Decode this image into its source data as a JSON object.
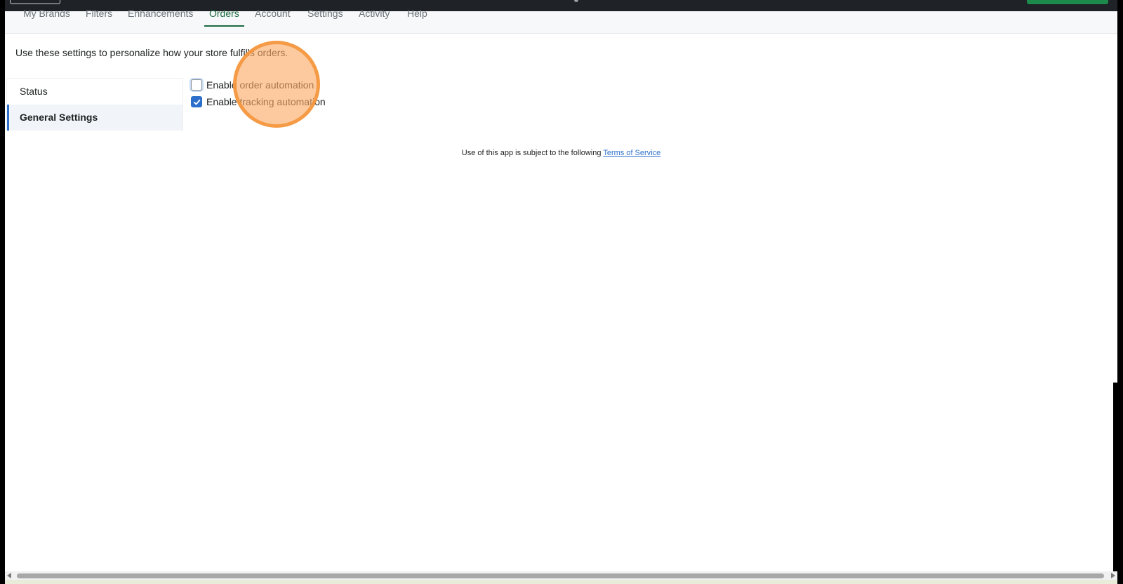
{
  "nav": {
    "tabs": [
      {
        "label": "My Brands"
      },
      {
        "label": "Filters"
      },
      {
        "label": "Enhancements"
      },
      {
        "label": "Orders"
      },
      {
        "label": "Account"
      },
      {
        "label": "Settings"
      },
      {
        "label": "Activity"
      },
      {
        "label": "Help"
      }
    ],
    "active_tab": "Orders"
  },
  "intro_text": "Use these settings to personalize how your store fulfills orders.",
  "sidebar": {
    "items": [
      {
        "label": "Status"
      },
      {
        "label": "General Settings"
      }
    ],
    "active_item": "General Settings"
  },
  "settings": {
    "order_automation": {
      "label": "Enable order automation",
      "checked": false
    },
    "tracking_automation": {
      "label": "Enable tracking automation",
      "checked": true
    }
  },
  "footer": {
    "text": "Use of this app is subject to the following ",
    "link_text": "Terms of Service"
  },
  "colors": {
    "accent_green": "#1b6b42",
    "checkbox_blue": "#2c6ecb",
    "highlight_orange": "#f5963c"
  }
}
